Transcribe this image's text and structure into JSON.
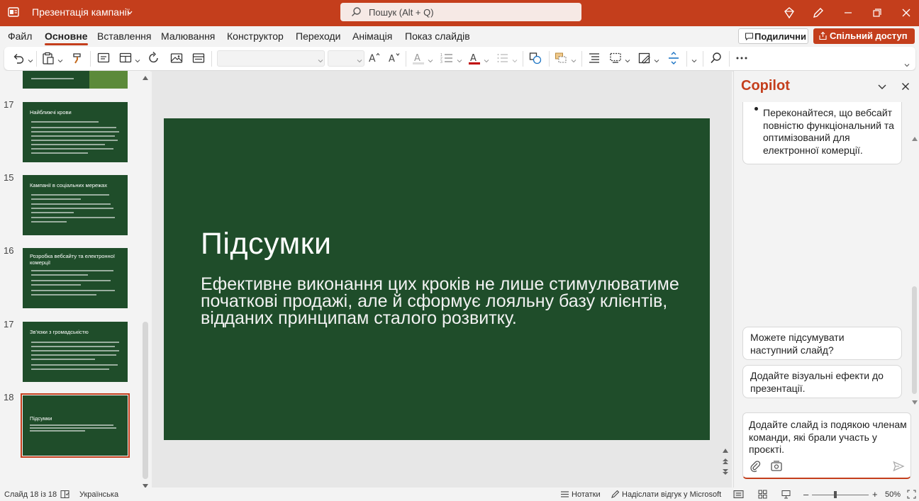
{
  "app": {
    "doc_title": "Презентація кампанії",
    "search_placeholder": "Пошук (Alt + Q)"
  },
  "menu": {
    "items": [
      "Файл",
      "Основне",
      "Вставлення",
      "Малювання",
      "Конструктор",
      "Переходи",
      "Анімація",
      "Показ слайдів"
    ],
    "active": "Основне",
    "subscribe_label": "Подилични",
    "share_label": "Спільний доступ"
  },
  "thumbnails": [
    {
      "number": "",
      "title": "",
      "partial": true
    },
    {
      "number": "17",
      "title": "Найближчі крови"
    },
    {
      "number": "15",
      "title": "Кампанії в соціальних мережах"
    },
    {
      "number": "16",
      "title": "Розробка вебсайту та електронної комерції"
    },
    {
      "number": "17",
      "title": "Зв'язки з громадськістю"
    },
    {
      "number": "18",
      "title": "Підсумки",
      "selected": true
    }
  ],
  "slide": {
    "title": "Підсумки",
    "body": "Ефективне виконання цих кроків не лише стимулюватиме початкові продажі, але й сформує лояльну базу клієнтів, відданих принципам сталого розвитку."
  },
  "copilot": {
    "title": "Copilot",
    "card_bullet": "Переконайтеся, що вебсайт повністю функціональний та оптимізований для електронної комерції.",
    "suggestions": [
      "Можете підсумувати наступний слайд?",
      "Додайте візуальні ефекти до презентації."
    ],
    "input_text": "Додайте слайд із подякою членам команди, які брали участь у проєкті."
  },
  "status": {
    "slide_counter": "Слайд 18 із 18",
    "language": "Українська",
    "notes_label": "Нотатки",
    "feedback_label": "Надіслати відгук у Microsoft",
    "zoom": "50%"
  },
  "colors": {
    "accent": "#c43e1c",
    "slide_bg": "#1f4d2a"
  }
}
